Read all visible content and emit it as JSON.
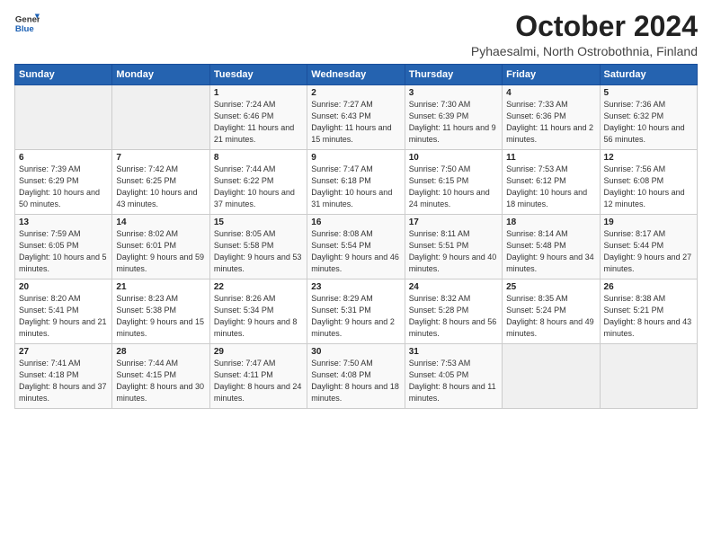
{
  "logo": {
    "general": "General",
    "blue": "Blue"
  },
  "title": "October 2024",
  "location": "Pyhaesalmi, North Ostrobothnia, Finland",
  "days_header": [
    "Sunday",
    "Monday",
    "Tuesday",
    "Wednesday",
    "Thursday",
    "Friday",
    "Saturday"
  ],
  "weeks": [
    [
      {
        "day": "",
        "empty": true
      },
      {
        "day": "",
        "empty": true
      },
      {
        "day": "1",
        "sunrise": "7:24 AM",
        "sunset": "6:46 PM",
        "daylight": "11 hours and 21 minutes."
      },
      {
        "day": "2",
        "sunrise": "7:27 AM",
        "sunset": "6:43 PM",
        "daylight": "11 hours and 15 minutes."
      },
      {
        "day": "3",
        "sunrise": "7:30 AM",
        "sunset": "6:39 PM",
        "daylight": "11 hours and 9 minutes."
      },
      {
        "day": "4",
        "sunrise": "7:33 AM",
        "sunset": "6:36 PM",
        "daylight": "11 hours and 2 minutes."
      },
      {
        "day": "5",
        "sunrise": "7:36 AM",
        "sunset": "6:32 PM",
        "daylight": "10 hours and 56 minutes."
      }
    ],
    [
      {
        "day": "6",
        "sunrise": "7:39 AM",
        "sunset": "6:29 PM",
        "daylight": "10 hours and 50 minutes."
      },
      {
        "day": "7",
        "sunrise": "7:42 AM",
        "sunset": "6:25 PM",
        "daylight": "10 hours and 43 minutes."
      },
      {
        "day": "8",
        "sunrise": "7:44 AM",
        "sunset": "6:22 PM",
        "daylight": "10 hours and 37 minutes."
      },
      {
        "day": "9",
        "sunrise": "7:47 AM",
        "sunset": "6:18 PM",
        "daylight": "10 hours and 31 minutes."
      },
      {
        "day": "10",
        "sunrise": "7:50 AM",
        "sunset": "6:15 PM",
        "daylight": "10 hours and 24 minutes."
      },
      {
        "day": "11",
        "sunrise": "7:53 AM",
        "sunset": "6:12 PM",
        "daylight": "10 hours and 18 minutes."
      },
      {
        "day": "12",
        "sunrise": "7:56 AM",
        "sunset": "6:08 PM",
        "daylight": "10 hours and 12 minutes."
      }
    ],
    [
      {
        "day": "13",
        "sunrise": "7:59 AM",
        "sunset": "6:05 PM",
        "daylight": "10 hours and 5 minutes."
      },
      {
        "day": "14",
        "sunrise": "8:02 AM",
        "sunset": "6:01 PM",
        "daylight": "9 hours and 59 minutes."
      },
      {
        "day": "15",
        "sunrise": "8:05 AM",
        "sunset": "5:58 PM",
        "daylight": "9 hours and 53 minutes."
      },
      {
        "day": "16",
        "sunrise": "8:08 AM",
        "sunset": "5:54 PM",
        "daylight": "9 hours and 46 minutes."
      },
      {
        "day": "17",
        "sunrise": "8:11 AM",
        "sunset": "5:51 PM",
        "daylight": "9 hours and 40 minutes."
      },
      {
        "day": "18",
        "sunrise": "8:14 AM",
        "sunset": "5:48 PM",
        "daylight": "9 hours and 34 minutes."
      },
      {
        "day": "19",
        "sunrise": "8:17 AM",
        "sunset": "5:44 PM",
        "daylight": "9 hours and 27 minutes."
      }
    ],
    [
      {
        "day": "20",
        "sunrise": "8:20 AM",
        "sunset": "5:41 PM",
        "daylight": "9 hours and 21 minutes."
      },
      {
        "day": "21",
        "sunrise": "8:23 AM",
        "sunset": "5:38 PM",
        "daylight": "9 hours and 15 minutes."
      },
      {
        "day": "22",
        "sunrise": "8:26 AM",
        "sunset": "5:34 PM",
        "daylight": "9 hours and 8 minutes."
      },
      {
        "day": "23",
        "sunrise": "8:29 AM",
        "sunset": "5:31 PM",
        "daylight": "9 hours and 2 minutes."
      },
      {
        "day": "24",
        "sunrise": "8:32 AM",
        "sunset": "5:28 PM",
        "daylight": "8 hours and 56 minutes."
      },
      {
        "day": "25",
        "sunrise": "8:35 AM",
        "sunset": "5:24 PM",
        "daylight": "8 hours and 49 minutes."
      },
      {
        "day": "26",
        "sunrise": "8:38 AM",
        "sunset": "5:21 PM",
        "daylight": "8 hours and 43 minutes."
      }
    ],
    [
      {
        "day": "27",
        "sunrise": "7:41 AM",
        "sunset": "4:18 PM",
        "daylight": "8 hours and 37 minutes."
      },
      {
        "day": "28",
        "sunrise": "7:44 AM",
        "sunset": "4:15 PM",
        "daylight": "8 hours and 30 minutes."
      },
      {
        "day": "29",
        "sunrise": "7:47 AM",
        "sunset": "4:11 PM",
        "daylight": "8 hours and 24 minutes."
      },
      {
        "day": "30",
        "sunrise": "7:50 AM",
        "sunset": "4:08 PM",
        "daylight": "8 hours and 18 minutes."
      },
      {
        "day": "31",
        "sunrise": "7:53 AM",
        "sunset": "4:05 PM",
        "daylight": "8 hours and 11 minutes."
      },
      {
        "day": "",
        "empty": true
      },
      {
        "day": "",
        "empty": true
      }
    ]
  ]
}
